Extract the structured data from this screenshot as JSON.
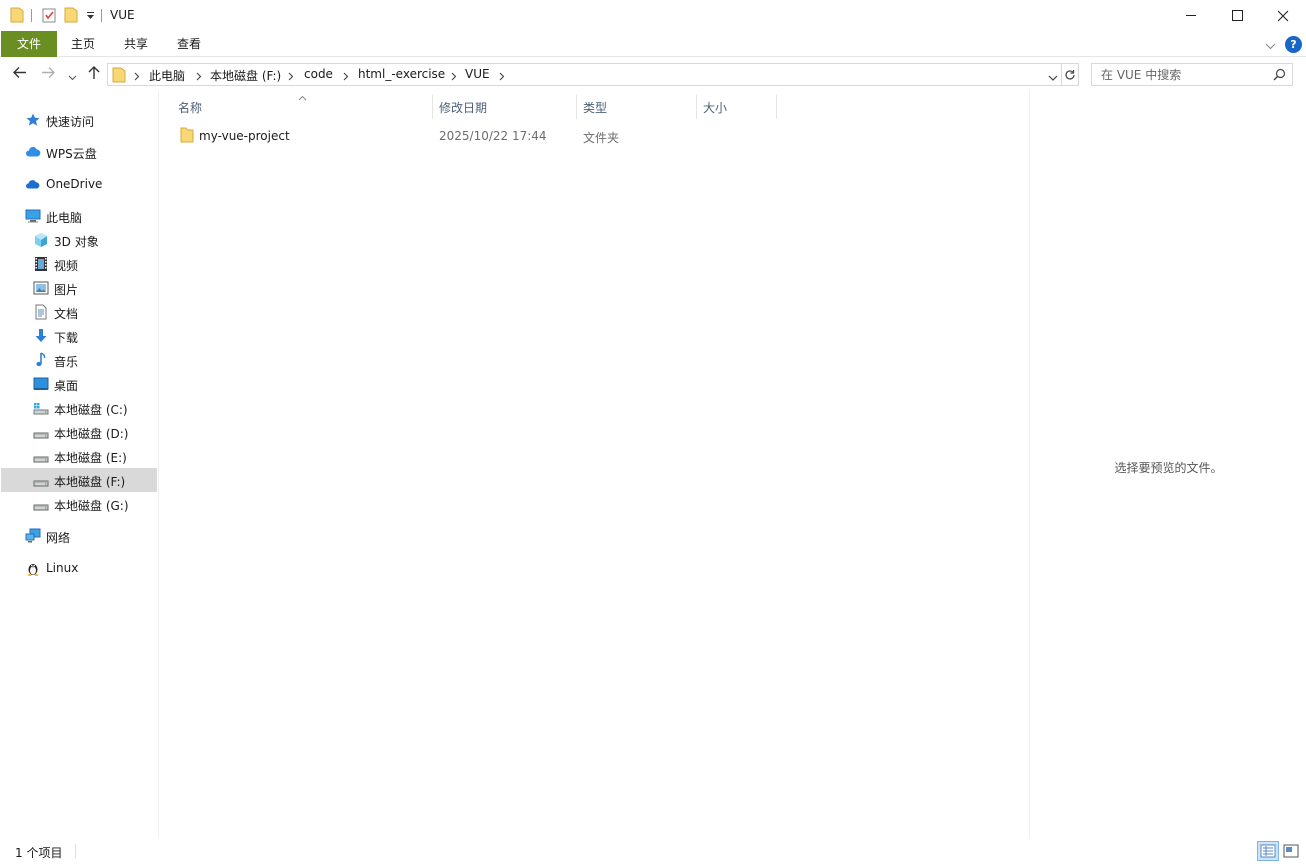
{
  "window": {
    "title": "VUE",
    "minimize_glyph": "─",
    "maximize_glyph": "☐",
    "close_glyph": "✕"
  },
  "ribbon": {
    "tabs": [
      "文件",
      "主页",
      "共享",
      "查看"
    ],
    "help_glyph": "?"
  },
  "address": {
    "breadcrumbs": [
      "此电脑",
      "本地磁盘 (F:)",
      "code",
      "html_-exercise",
      "VUE"
    ]
  },
  "search": {
    "placeholder": "在 VUE 中搜索"
  },
  "nav": {
    "items": [
      {
        "label": "快速访问",
        "icon": "star-icon"
      },
      {
        "label": "WPS云盘",
        "icon": "cloud-icon"
      },
      {
        "label": "OneDrive",
        "icon": "onedrive-icon"
      },
      {
        "label": "此电脑",
        "icon": "computer-icon"
      },
      {
        "label": "3D 对象",
        "icon": "cube-icon"
      },
      {
        "label": "视频",
        "icon": "video-icon"
      },
      {
        "label": "图片",
        "icon": "picture-icon"
      },
      {
        "label": "文档",
        "icon": "document-icon"
      },
      {
        "label": "下载",
        "icon": "download-icon"
      },
      {
        "label": "音乐",
        "icon": "music-icon"
      },
      {
        "label": "桌面",
        "icon": "desktop-icon"
      },
      {
        "label": "本地磁盘 (C:)",
        "icon": "system-drive-icon"
      },
      {
        "label": "本地磁盘 (D:)",
        "icon": "drive-icon"
      },
      {
        "label": "本地磁盘 (E:)",
        "icon": "drive-icon"
      },
      {
        "label": "本地磁盘 (F:)",
        "icon": "drive-icon"
      },
      {
        "label": "本地磁盘 (G:)",
        "icon": "drive-icon"
      },
      {
        "label": "网络",
        "icon": "network-icon"
      },
      {
        "label": "Linux",
        "icon": "linux-icon"
      }
    ],
    "selected": "本地磁盘 (F:)"
  },
  "filelist": {
    "columns": [
      "名称",
      "修改日期",
      "类型",
      "大小"
    ],
    "rows": [
      {
        "name": "my-vue-project",
        "modified": "2025/10/22 17:44",
        "type": "文件夹",
        "size": ""
      }
    ]
  },
  "preview": {
    "message": "选择要预览的文件。"
  },
  "status": {
    "item_count": "1 个项目"
  },
  "colors": {
    "file_tab": "#6b8e23",
    "selection": "#d9d9d9",
    "header_text": "#4c607a",
    "folder": "#f8d775"
  }
}
